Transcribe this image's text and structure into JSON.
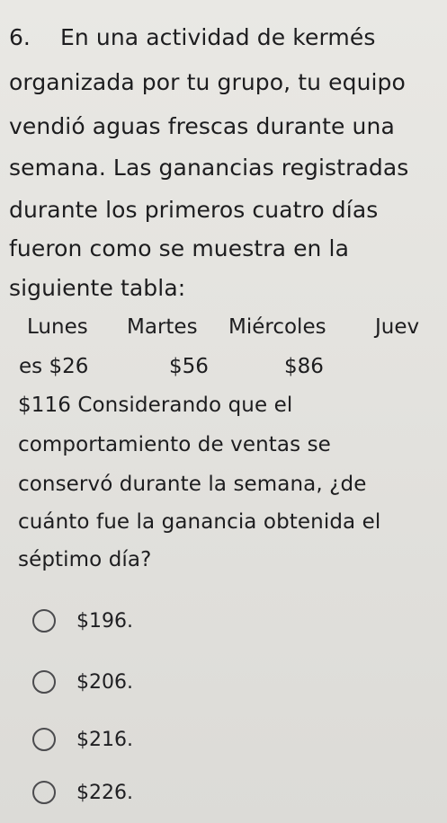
{
  "question": {
    "number": "6.",
    "lines": [
      "En una actividad de kermés",
      "organizada por tu grupo, tu equipo",
      "vendió aguas frescas durante una",
      "semana. Las ganancias registradas",
      "durante los primeros cuatro días",
      "fueron como se muestra en la",
      "siguiente tabla:"
    ]
  },
  "table": {
    "headers": [
      "Lunes",
      "Martes",
      "Miércoles",
      "Juev"
    ],
    "row2": [
      "es $26",
      "$56",
      "$86"
    ]
  },
  "continuation": {
    "lines": [
      "$116 Considerando que el",
      "comportamiento de ventas se",
      "conservó durante la semana, ¿de",
      "cuánto fue la ganancia obtenida el",
      "séptimo día?"
    ]
  },
  "options": [
    {
      "label": "$196."
    },
    {
      "label": "$206."
    },
    {
      "label": "$216."
    },
    {
      "label": "$226."
    }
  ]
}
